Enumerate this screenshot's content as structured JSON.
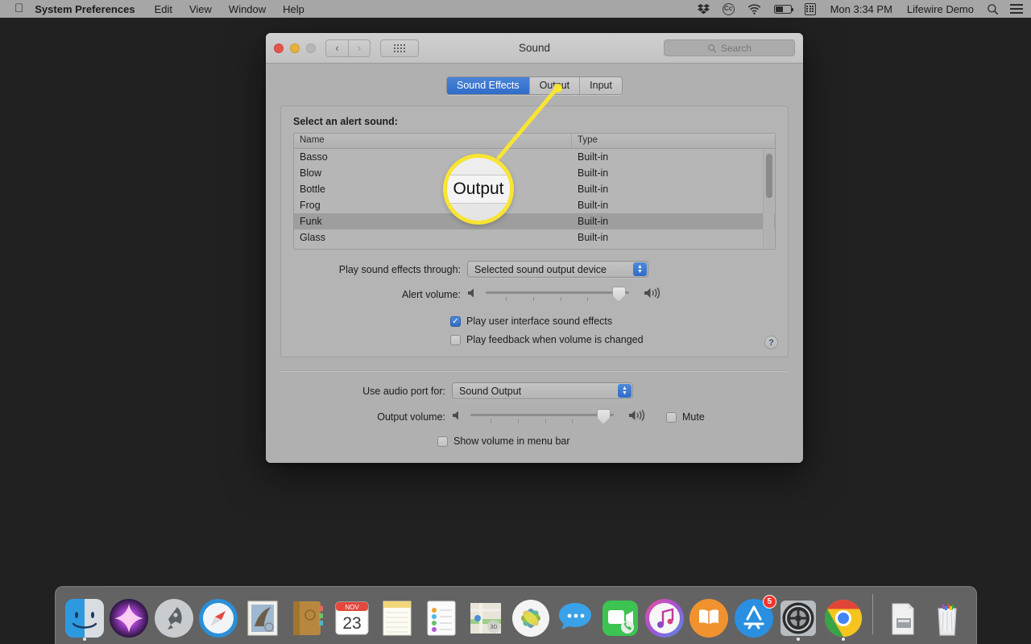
{
  "menubar": {
    "apple_icon": "apple-logo",
    "app_name": "System Preferences",
    "items": [
      "Edit",
      "View",
      "Window",
      "Help"
    ],
    "status_icons": [
      "dropbox-icon",
      "creative-cloud-icon",
      "wifi-icon",
      "battery-icon",
      "calculator-icon"
    ],
    "clock": "Mon 3:34 PM",
    "user": "Lifewire Demo",
    "right_icons": [
      "search-icon",
      "control-center-icon"
    ]
  },
  "window": {
    "title": "Sound",
    "traffic_lights": [
      "close",
      "minimize",
      "zoom"
    ],
    "nav_back": "‹",
    "nav_forward": "›",
    "grid_button": "show-all-grid",
    "search_placeholder": "Search",
    "tabs": [
      {
        "label": "Sound Effects",
        "active": true
      },
      {
        "label": "Output",
        "active": false
      },
      {
        "label": "Input",
        "active": false
      }
    ],
    "alert_sound": {
      "section_label": "Select an alert sound:",
      "columns": [
        "Name",
        "Type"
      ],
      "rows": [
        {
          "name": "Basso",
          "type": "Built-in",
          "selected": false
        },
        {
          "name": "Blow",
          "type": "Built-in",
          "selected": false
        },
        {
          "name": "Bottle",
          "type": "Built-in",
          "selected": false
        },
        {
          "name": "Frog",
          "type": "Built-in",
          "selected": false
        },
        {
          "name": "Funk",
          "type": "Built-in",
          "selected": true
        },
        {
          "name": "Glass",
          "type": "Built-in",
          "selected": false
        }
      ]
    },
    "play_through": {
      "label": "Play sound effects through:",
      "value": "Selected sound output device"
    },
    "alert_volume": {
      "label": "Alert volume:",
      "value_percent": 88
    },
    "checkbox_ui_sounds": {
      "label": "Play user interface sound effects",
      "checked": true
    },
    "checkbox_feedback": {
      "label": "Play feedback when volume is changed",
      "checked": false
    },
    "help_button": "?",
    "audio_port": {
      "label": "Use audio port for:",
      "value": "Sound Output"
    },
    "output_volume": {
      "label": "Output volume:",
      "value_percent": 88
    },
    "mute": {
      "label": "Mute",
      "checked": false
    },
    "checkbox_menubar_volume": {
      "label": "Show volume in menu bar",
      "checked": false
    }
  },
  "callout": {
    "text": "Output",
    "ring_color": "#f7e434"
  },
  "dock": {
    "items": [
      {
        "name": "finder",
        "running": true,
        "badge": null
      },
      {
        "name": "siri",
        "running": false,
        "badge": null
      },
      {
        "name": "launchpad",
        "running": false,
        "badge": null
      },
      {
        "name": "safari",
        "running": false,
        "badge": null
      },
      {
        "name": "mail",
        "running": false,
        "badge": null
      },
      {
        "name": "contacts",
        "running": false,
        "badge": null
      },
      {
        "name": "calendar",
        "running": false,
        "badge": null
      },
      {
        "name": "notes",
        "running": false,
        "badge": null
      },
      {
        "name": "reminders",
        "running": false,
        "badge": null
      },
      {
        "name": "maps",
        "running": false,
        "badge": null
      },
      {
        "name": "photos",
        "running": false,
        "badge": null
      },
      {
        "name": "messages",
        "running": false,
        "badge": null
      },
      {
        "name": "facetime",
        "running": false,
        "badge": null
      },
      {
        "name": "itunes",
        "running": false,
        "badge": null
      },
      {
        "name": "books",
        "running": false,
        "badge": null
      },
      {
        "name": "app-store",
        "running": false,
        "badge": "5"
      },
      {
        "name": "system-preferences",
        "running": true,
        "badge": null
      },
      {
        "name": "google-chrome",
        "running": true,
        "badge": null
      }
    ],
    "trailing": [
      {
        "name": "downloads-stack"
      },
      {
        "name": "trash"
      }
    ],
    "calendar_month": "NOV",
    "calendar_day": "23"
  }
}
